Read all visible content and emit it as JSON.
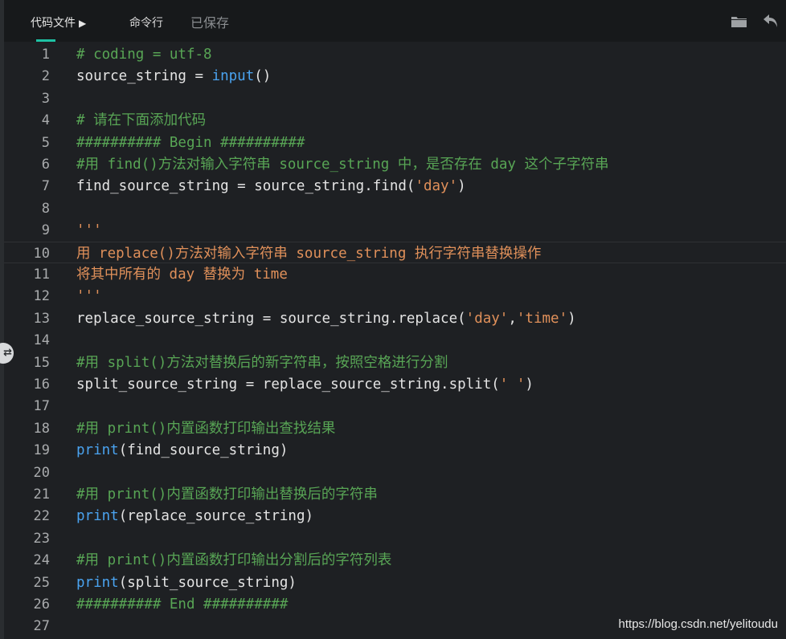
{
  "toolbar": {
    "code_tab_label": "代码文件",
    "code_tab_arrow": "▶",
    "cli_tab_label": "命令行",
    "saved_status": "已保存",
    "folder_icon": "folder-icon",
    "undo_icon": "undo-icon",
    "accent_color": "#1ec1a4"
  },
  "side_handle": {
    "icon": "swap-arrows-icon",
    "glyph": "⇄"
  },
  "editor": {
    "active_line": 10,
    "colors": {
      "background": "#1e2023",
      "comment": "#58a555",
      "string": "#e0905a",
      "builtin": "#4aa3f0",
      "text": "#e4e4e4",
      "line_number": "#a9abad"
    },
    "lines": [
      {
        "n": "1",
        "tokens": [
          {
            "t": "# coding = utf-8",
            "c": "comment"
          }
        ]
      },
      {
        "n": "2",
        "tokens": [
          {
            "t": "source_string = ",
            "c": "plain"
          },
          {
            "t": "input",
            "c": "builtin"
          },
          {
            "t": "()",
            "c": "plain"
          }
        ]
      },
      {
        "n": "3",
        "tokens": []
      },
      {
        "n": "4",
        "tokens": [
          {
            "t": "# 请在下面添加代码",
            "c": "comment"
          }
        ]
      },
      {
        "n": "5",
        "tokens": [
          {
            "t": "########## Begin ##########",
            "c": "comment"
          }
        ]
      },
      {
        "n": "6",
        "tokens": [
          {
            "t": "#用 find()方法对输入字符串 source_string 中，是否存在 day 这个子字符串",
            "c": "comment"
          }
        ]
      },
      {
        "n": "7",
        "tokens": [
          {
            "t": "find_source_string = source_string.find(",
            "c": "plain"
          },
          {
            "t": "'day'",
            "c": "string"
          },
          {
            "t": ")",
            "c": "plain"
          }
        ]
      },
      {
        "n": "8",
        "tokens": []
      },
      {
        "n": "9",
        "tokens": [
          {
            "t": "'''",
            "c": "string"
          }
        ]
      },
      {
        "n": "10",
        "tokens": [
          {
            "t": "用 replace()方法对输入字符串 source_string 执行字符串替换操作",
            "c": "string"
          }
        ]
      },
      {
        "n": "11",
        "tokens": [
          {
            "t": "将其中所有的 day 替换为 time",
            "c": "string"
          }
        ]
      },
      {
        "n": "12",
        "tokens": [
          {
            "t": "'''",
            "c": "string"
          }
        ]
      },
      {
        "n": "13",
        "tokens": [
          {
            "t": "replace_source_string = source_string.replace(",
            "c": "plain"
          },
          {
            "t": "'day'",
            "c": "string"
          },
          {
            "t": ",",
            "c": "plain"
          },
          {
            "t": "'time'",
            "c": "string"
          },
          {
            "t": ")",
            "c": "plain"
          }
        ]
      },
      {
        "n": "14",
        "tokens": []
      },
      {
        "n": "15",
        "tokens": [
          {
            "t": "#用 split()方法对替换后的新字符串，按照空格进行分割",
            "c": "comment"
          }
        ]
      },
      {
        "n": "16",
        "tokens": [
          {
            "t": "split_source_string = replace_source_string.split(",
            "c": "plain"
          },
          {
            "t": "' '",
            "c": "string"
          },
          {
            "t": ")",
            "c": "plain"
          }
        ]
      },
      {
        "n": "17",
        "tokens": []
      },
      {
        "n": "18",
        "tokens": [
          {
            "t": "#用 print()内置函数打印输出查找结果",
            "c": "comment"
          }
        ]
      },
      {
        "n": "19",
        "tokens": [
          {
            "t": "print",
            "c": "builtin"
          },
          {
            "t": "(find_source_string)",
            "c": "plain"
          }
        ]
      },
      {
        "n": "20",
        "tokens": []
      },
      {
        "n": "21",
        "tokens": [
          {
            "t": "#用 print()内置函数打印输出替换后的字符串",
            "c": "comment"
          }
        ]
      },
      {
        "n": "22",
        "tokens": [
          {
            "t": "print",
            "c": "builtin"
          },
          {
            "t": "(replace_source_string)",
            "c": "plain"
          }
        ]
      },
      {
        "n": "23",
        "tokens": []
      },
      {
        "n": "24",
        "tokens": [
          {
            "t": "#用 print()内置函数打印输出分割后的字符列表",
            "c": "comment"
          }
        ]
      },
      {
        "n": "25",
        "tokens": [
          {
            "t": "print",
            "c": "builtin"
          },
          {
            "t": "(split_source_string)",
            "c": "plain"
          }
        ]
      },
      {
        "n": "26",
        "tokens": [
          {
            "t": "########## End ##########",
            "c": "comment"
          }
        ]
      },
      {
        "n": "27",
        "tokens": []
      }
    ]
  },
  "watermark": "https://blog.csdn.net/yelitoudu"
}
